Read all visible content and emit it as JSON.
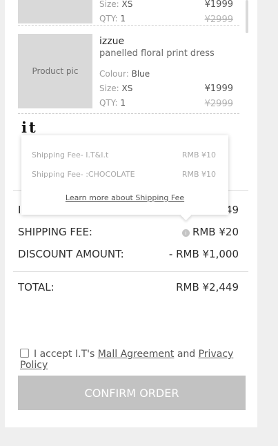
{
  "products": [
    {
      "size_label": "Size:",
      "size_value": "XS",
      "qty_label": "QTY:",
      "qty_value": "1",
      "price": "¥1999",
      "original_price": "¥2999"
    },
    {
      "pic_label": "Product pic",
      "brand": "izzue",
      "name": "panelled floral print dress",
      "colour_label": "Colour:",
      "colour_value": "Blue",
      "size_label": "Size:",
      "size_value": "XS",
      "qty_label": "QTY:",
      "qty_value": "1",
      "price": "¥1999",
      "original_price": "¥2999"
    }
  ],
  "store_logo": "it",
  "summary": {
    "item_label_partial": "I",
    "item_amount_partial": "49",
    "shipping_label": "SHIPPING FEE:",
    "shipping_amount": "RMB ¥20",
    "discount_label": "DISCOUNT AMOUNT:",
    "discount_amount": "- RMB ¥1,000",
    "total_label": "TOTAL:",
    "total_amount": "RMB ¥2,449"
  },
  "shipping_tooltip": {
    "rows": [
      {
        "label": "Shipping Fee- I.T&I.t",
        "fee": "RMB ¥10"
      },
      {
        "label": "Shipping Fee- :CHOCOLATE",
        "fee": "RMB ¥10"
      }
    ],
    "learn_more": "Learn more about Shipping Fee"
  },
  "agreement": {
    "prefix": "I accept I.T's",
    "mall_agreement": "Mall Agreement",
    "and": "and",
    "privacy_policy": "Privacy Policy"
  },
  "confirm_button": "CONFIRM ORDER",
  "colors": {
    "background": "#efefef",
    "panel": "#ffffff",
    "placeholder": "#d9d9d9",
    "button_disabled": "#c2c2c2"
  }
}
